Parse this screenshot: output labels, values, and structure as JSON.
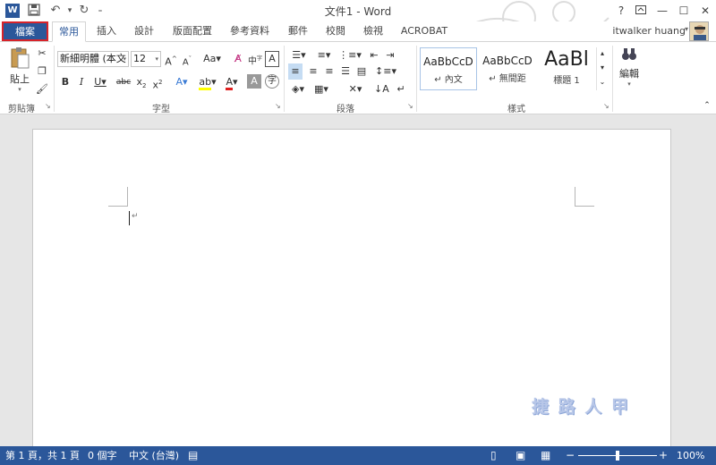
{
  "title_bar": {
    "title": "文件1 - Word",
    "app_icon_letter": "W",
    "help": "?",
    "minimize": "—",
    "maximize": "☐",
    "close": "✕"
  },
  "tabs": {
    "file": "檔案",
    "items": [
      "常用",
      "插入",
      "設計",
      "版面配置",
      "參考資料",
      "郵件",
      "校閱",
      "檢視",
      "ACROBAT"
    ],
    "active_index": 0,
    "user": "itwalker huang"
  },
  "ribbon": {
    "clipboard": {
      "paste": "貼上",
      "label": "剪貼簿"
    },
    "font": {
      "font_name": "新細明體 (本文",
      "font_size": "12",
      "label": "字型"
    },
    "paragraph": {
      "label": "段落"
    },
    "styles": {
      "label": "樣式",
      "items": [
        {
          "sample": "AaBbCcD",
          "name": "↵ 內文"
        },
        {
          "sample": "AaBbCcD",
          "name": "↵ 無間距"
        },
        {
          "sample": "AaBl",
          "name": "標題 1"
        }
      ]
    },
    "editing": {
      "label": "編輯"
    }
  },
  "watermark": "捷 路 人 甲",
  "status_bar": {
    "page": "第 1 頁，共 1 頁",
    "words": "0 個字",
    "language": "中文 (台灣)",
    "zoom": "100%",
    "zoom_level": 0.5
  },
  "colors": {
    "accent": "#2b579a",
    "file_tab_outline": "#d8232a",
    "workspace": "#e6e6e6"
  }
}
